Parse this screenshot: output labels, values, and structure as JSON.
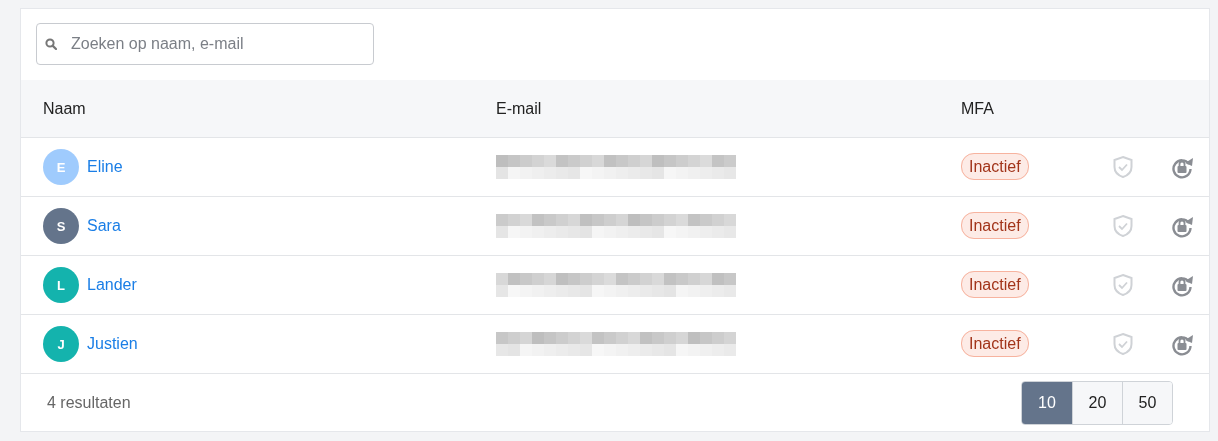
{
  "search": {
    "placeholder": "Zoeken op naam, e-mail"
  },
  "table": {
    "columns": [
      "Naam",
      "E-mail",
      "MFA"
    ],
    "rows": [
      {
        "initial": "E",
        "color": "#9fcbfd",
        "name": "Eline",
        "email_redacted": true,
        "mfa": "Inactief"
      },
      {
        "initial": "S",
        "color": "#64748b",
        "name": "Sara",
        "email_redacted": true,
        "mfa": "Inactief"
      },
      {
        "initial": "L",
        "color": "#14b3ad",
        "name": "Lander",
        "email_redacted": true,
        "mfa": "Inactief"
      },
      {
        "initial": "J",
        "color": "#14b3ad",
        "name": "Justien",
        "email_redacted": true,
        "mfa": "Inactief"
      }
    ]
  },
  "footer": {
    "count": "4 resultaten",
    "page_sizes": [
      {
        "label": "10",
        "selected": true
      },
      {
        "label": "20",
        "selected": false
      },
      {
        "label": "50",
        "selected": false
      }
    ]
  }
}
